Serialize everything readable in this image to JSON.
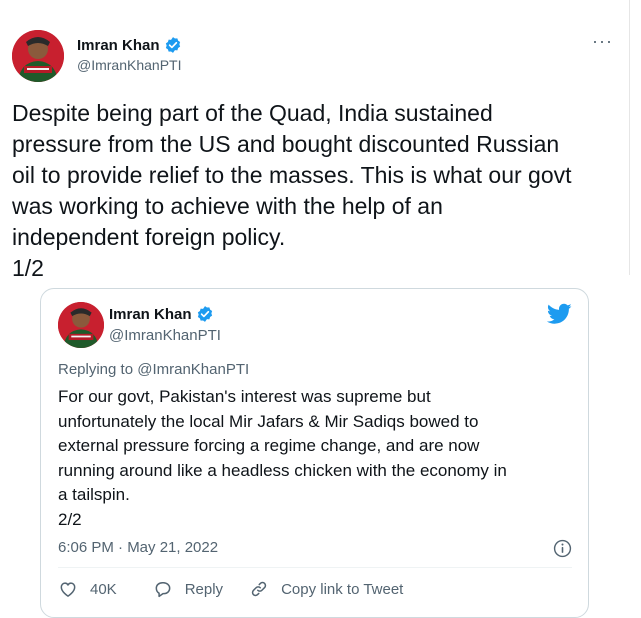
{
  "outer_tweet": {
    "author_name": "Imran Khan",
    "handle": "@ImranKhanPTI",
    "more_label": "···",
    "text": "Despite being part of the Quad, India sustained\npressure from the US and bought discounted Russian\noil to provide relief to the masses. This is what our govt\nwas working to achieve with the help of an\nindependent foreign policy.\n1/2"
  },
  "quoted_tweet": {
    "author_name": "Imran Khan",
    "handle": "@ImranKhanPTI",
    "reply_to": "Replying to @ImranKhanPTI",
    "text": "For our govt, Pakistan's interest was supreme but\nunfortunately the local Mir Jafars & Mir Sadiqs bowed to\nexternal pressure forcing a regime change, and are now\nrunning around like a headless chicken with the economy in\na tailspin.\n2/2",
    "timestamp": "6:06 PM · May 21, 2022",
    "actions": {
      "likes": "40K",
      "reply_label": "Reply",
      "copy_link_label": "Copy link to Tweet"
    }
  },
  "colors": {
    "verified_blue": "#1d9bf0",
    "twitter_blue": "#1d9bf0",
    "secondary_text": "#536471",
    "primary_text": "#0f1419",
    "card_border": "#cfd9de"
  },
  "icons": {
    "verified": "verified-badge-icon",
    "more": "more-options-icon",
    "bird": "twitter-bird-icon",
    "info": "info-icon",
    "heart": "heart-icon",
    "reply": "reply-bubble-icon",
    "link": "link-icon"
  }
}
